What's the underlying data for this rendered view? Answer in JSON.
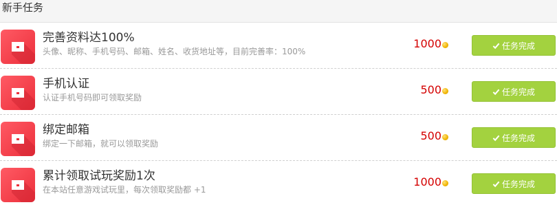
{
  "header": {
    "title": "新手任务"
  },
  "tasks": [
    {
      "title": "完善资料达100%",
      "desc": "头像、昵称、手机号码、邮箱、姓名、收货地址等，目前完善率：100%",
      "reward": "1000",
      "button_label": "任务完成"
    },
    {
      "title": "手机认证",
      "desc": "认证手机号码即可领取奖励",
      "reward": "500",
      "button_label": "任务完成"
    },
    {
      "title": "绑定邮箱",
      "desc": "绑定一下邮箱，就可以领取奖励",
      "reward": "500",
      "button_label": "任务完成"
    },
    {
      "title": "累计领取试玩奖励1次",
      "desc": "在本站任意游戏试玩里，每次领取奖励都 +1",
      "reward": "1000",
      "button_label": "任务完成"
    }
  ],
  "icons": {
    "task": "gift-box-icon",
    "coin": "coin-icon",
    "check": "check-icon"
  },
  "colors": {
    "icon_red": "#ec2f3b",
    "reward_red": "#d40000",
    "button_green": "#a3d23f"
  }
}
